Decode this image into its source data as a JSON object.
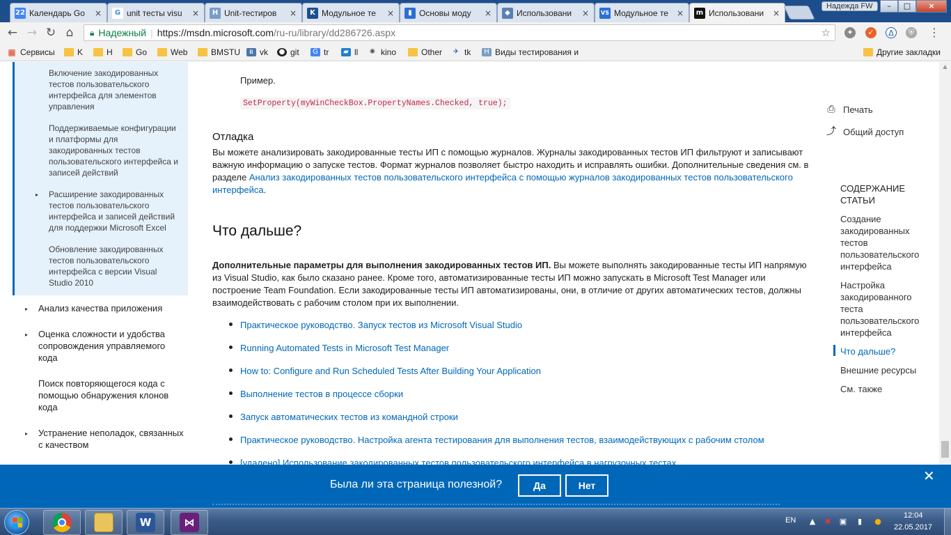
{
  "browser": {
    "tabs": [
      {
        "title": "Календарь Go",
        "icon_text": "22",
        "icon_color": "#4285f4"
      },
      {
        "title": "unit тесты visu",
        "icon_text": "G",
        "icon_color": "#4285f4"
      },
      {
        "title": "Unit-тестиров",
        "icon_text": "H",
        "icon_color": "#7a9cc6"
      },
      {
        "title": "Модульное те",
        "icon_text": "K",
        "icon_color": "#1f4e8c"
      },
      {
        "title": "Основы моду",
        "icon_text": "▮",
        "icon_color": "#2a6fd6"
      },
      {
        "title": "Использовани",
        "icon_text": "◆",
        "icon_color": "#5a7fb5"
      },
      {
        "title": "Модульное те",
        "icon_text": "VS",
        "icon_color": "#2a6fd6"
      },
      {
        "title": "Использовани",
        "icon_text": "m",
        "icon_color": "#111111"
      }
    ],
    "tab_close_glyph": "×",
    "user_name": "Надежда FW",
    "window_controls": {
      "minimize": "–",
      "maximize": "□",
      "close": "×"
    },
    "nav": {
      "back": "←",
      "forward": "→",
      "reload": "↻",
      "home": "⌂"
    },
    "secure_label": "Надежный",
    "url_host": "https://msdn.microsoft.com",
    "url_path": "/ru-ru/library/dd286726.aspx",
    "bookmark_star": "☆",
    "bookmarks": [
      {
        "label": "Сервисы",
        "icon": "apps-icon"
      },
      {
        "label": "K",
        "icon": "folder-icon"
      },
      {
        "label": "H",
        "icon": "folder-icon"
      },
      {
        "label": "Go",
        "icon": "folder-icon"
      },
      {
        "label": "Web",
        "icon": "folder-icon"
      },
      {
        "label": "BMSTU",
        "icon": "folder-icon"
      },
      {
        "label": "vk",
        "icon": "vk-icon"
      },
      {
        "label": "git",
        "icon": "github-icon"
      },
      {
        "label": "tr",
        "icon": "translate-icon"
      },
      {
        "label": "ll",
        "icon": "book-icon"
      },
      {
        "label": "kino",
        "icon": "film-icon"
      },
      {
        "label": "Other",
        "icon": "folder-icon"
      },
      {
        "label": "tk",
        "icon": "plane-icon"
      },
      {
        "label": "Виды тестирования и",
        "icon": "h-icon"
      }
    ],
    "other_bookmarks": "Другие закладки"
  },
  "leftnav": {
    "sub_items": [
      "Включение закодированных тестов пользовательского интерфейса для элементов управления",
      "Поддерживаемые конфигурации и платформы для закодированных тестов пользовательского интерфейса и записей действий",
      "Расширение закодированных тестов пользовательского интерфейса и записей действий для поддержки Microsoft Excel",
      "Обновление закодированных тестов пользовательского интерфейса с версии Visual Studio 2010"
    ],
    "items": [
      "Анализ качества приложения",
      "Оценка сложности и удобства сопровождения управляемого кода",
      "Поиск повторяющегося кода с помощью обнаружения клонов кода",
      "Устранение неполадок, связанных с качеством"
    ],
    "bullet": "▸"
  },
  "content": {
    "example_label": "Пример.",
    "code": "SetProperty(myWinCheckBox.PropertyNames.Checked, true);",
    "debug_heading": "Отладка",
    "debug_text": "Вы можете анализировать закодированные тесты ИП с помощью журналов. Журналы закодированных тестов ИП фильтруют и записывают важную информацию о запуске тестов. Формат журналов позволяет быстро находить и исправлять ошибки. Дополнительные сведения см. в разделе ",
    "debug_link": "Анализ закодированных тестов пользовательского интерфейса с помощью журналов закодированных тестов пользовательского интерфейса",
    "debug_end": ".",
    "next_heading": "Что дальше?",
    "next_bold": "Дополнительные параметры для выполнения закодированных тестов ИП.",
    "next_text": " Вы можете выполнять закодированные тесты ИП напрямую из Visual Studio, как было сказано ранее. Кроме того, автоматизированные тесты ИП можно запускать в Microsoft Test Manager или построение Team Foundation. Если закодированные тесты ИП автоматизированы, они, в отличие от других автоматических тестов, должны взаимодействовать с рабочим столом при их выполнении.",
    "links": [
      "Практическое руководство. Запуск тестов из Microsoft Visual Studio",
      "Running Automated Tests in Microsoft Test Manager",
      "How to: Configure and Run Scheduled Tests After Building Your Application",
      "Выполнение тестов в процессе сборки",
      "Запуск автоматических тестов из командной строки",
      "Практическое руководство. Настройка агента тестирования для выполнения тестов, взаимодействующих с рабочим столом",
      "[удалено] Использование закодированных тестов пользовательского интерфейса в нагрузочных тестах"
    ]
  },
  "rightcol": {
    "print": "Печать",
    "share": "Общий доступ",
    "toc_heading": "СОДЕРЖАНИЕ СТАТЬИ",
    "toc": [
      "Создание закодированных тестов пользовательского интерфейса",
      "Настройка закодированного теста пользовательского интерфейса",
      "Что дальше?",
      "Внешние ресурсы",
      "См. также"
    ],
    "active_index": 2
  },
  "feedback": {
    "question": "Была ли эта страница полезной?",
    "yes": "Да",
    "no": "Нет",
    "close": "✕"
  },
  "taskbar": {
    "lang": "EN",
    "time": "12:04",
    "date": "22.05.2017"
  },
  "colors": {
    "accent": "#0067b8",
    "titlebar": "#1e4d8c",
    "code_text": "#c7254e"
  }
}
